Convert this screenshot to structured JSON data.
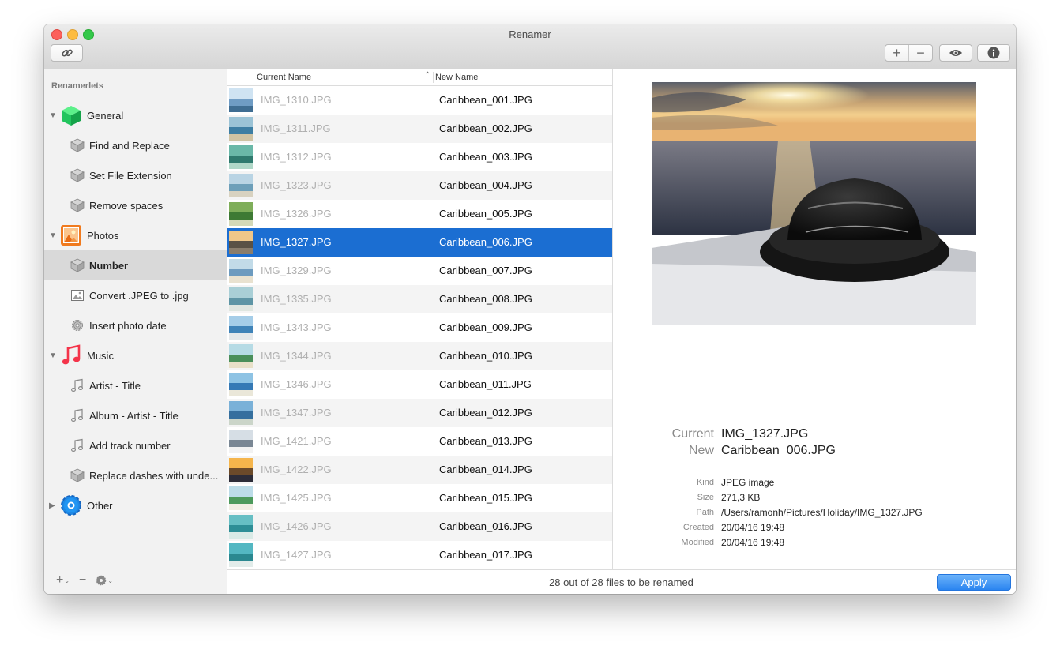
{
  "window": {
    "title": "Renamer"
  },
  "sidebar": {
    "heading": "Renamerlets",
    "groups": [
      {
        "label": "General",
        "children": [
          "Find and Replace",
          "Set File Extension",
          "Remove spaces"
        ]
      },
      {
        "label": "Photos",
        "children": [
          "Number",
          "Convert .JPEG to .jpg",
          "Insert photo date"
        ]
      },
      {
        "label": "Music",
        "children": [
          "Artist - Title",
          "Album - Artist - Title",
          "Add track number",
          "Replace dashes with unde..."
        ]
      },
      {
        "label": "Other",
        "children": []
      }
    ],
    "selected": "Number"
  },
  "list": {
    "col_current": "Current Name",
    "col_new": "New Name",
    "rows": [
      {
        "current": "IMG_1310.JPG",
        "new": "Caribbean_001.JPG"
      },
      {
        "current": "IMG_1311.JPG",
        "new": "Caribbean_002.JPG"
      },
      {
        "current": "IMG_1312.JPG",
        "new": "Caribbean_003.JPG"
      },
      {
        "current": "IMG_1323.JPG",
        "new": "Caribbean_004.JPG"
      },
      {
        "current": "IMG_1326.JPG",
        "new": "Caribbean_005.JPG"
      },
      {
        "current": "IMG_1327.JPG",
        "new": "Caribbean_006.JPG"
      },
      {
        "current": "IMG_1329.JPG",
        "new": "Caribbean_007.JPG"
      },
      {
        "current": "IMG_1335.JPG",
        "new": "Caribbean_008.JPG"
      },
      {
        "current": "IMG_1343.JPG",
        "new": "Caribbean_009.JPG"
      },
      {
        "current": "IMG_1344.JPG",
        "new": "Caribbean_010.JPG"
      },
      {
        "current": "IMG_1346.JPG",
        "new": "Caribbean_011.JPG"
      },
      {
        "current": "IMG_1347.JPG",
        "new": "Caribbean_012.JPG"
      },
      {
        "current": "IMG_1421.JPG",
        "new": "Caribbean_013.JPG"
      },
      {
        "current": "IMG_1422.JPG",
        "new": "Caribbean_014.JPG"
      },
      {
        "current": "IMG_1425.JPG",
        "new": "Caribbean_015.JPG"
      },
      {
        "current": "IMG_1426.JPG",
        "new": "Caribbean_016.JPG"
      },
      {
        "current": "IMG_1427.JPG",
        "new": "Caribbean_017.JPG"
      }
    ],
    "selected_index": 5
  },
  "preview": {
    "current_label": "Current",
    "current_value": "IMG_1327.JPG",
    "new_label": "New",
    "new_value": "Caribbean_006.JPG",
    "kind_label": "Kind",
    "kind_value": "JPEG image",
    "size_label": "Size",
    "size_value": "271,3 KB",
    "path_label": "Path",
    "path_value": "/Users/ramonh/Pictures/Holiday/IMG_1327.JPG",
    "created_label": "Created",
    "created_value": "20/04/16 19:48",
    "modified_label": "Modified",
    "modified_value": "20/04/16 19:48"
  },
  "status": {
    "text": "28 out of 28 files to be renamed",
    "apply_label": "Apply"
  },
  "colors": {
    "selection": "#1b6ed2",
    "apply": "#2a84f0"
  }
}
